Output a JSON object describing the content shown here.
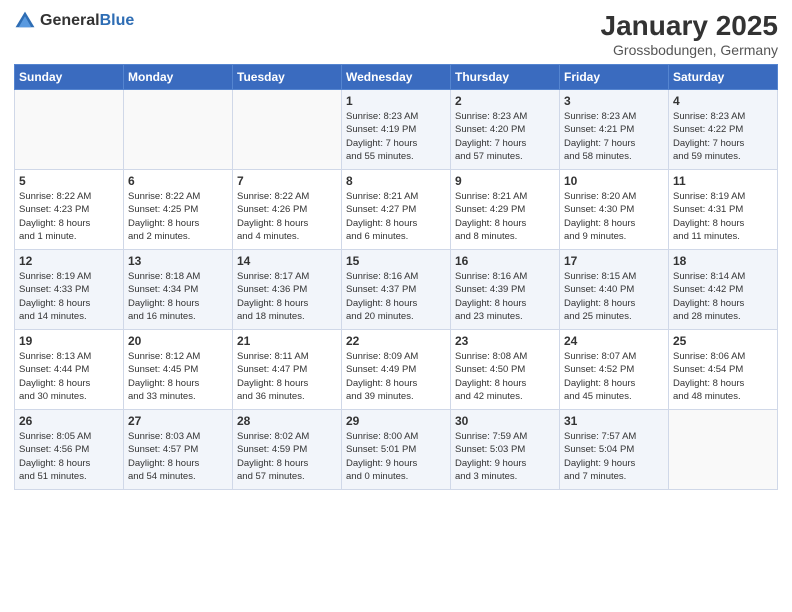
{
  "logo": {
    "general": "General",
    "blue": "Blue"
  },
  "header": {
    "title": "January 2025",
    "location": "Grossbodungen, Germany"
  },
  "days_of_week": [
    "Sunday",
    "Monday",
    "Tuesday",
    "Wednesday",
    "Thursday",
    "Friday",
    "Saturday"
  ],
  "weeks": [
    [
      {
        "day": "",
        "info": ""
      },
      {
        "day": "",
        "info": ""
      },
      {
        "day": "",
        "info": ""
      },
      {
        "day": "1",
        "info": "Sunrise: 8:23 AM\nSunset: 4:19 PM\nDaylight: 7 hours\nand 55 minutes."
      },
      {
        "day": "2",
        "info": "Sunrise: 8:23 AM\nSunset: 4:20 PM\nDaylight: 7 hours\nand 57 minutes."
      },
      {
        "day": "3",
        "info": "Sunrise: 8:23 AM\nSunset: 4:21 PM\nDaylight: 7 hours\nand 58 minutes."
      },
      {
        "day": "4",
        "info": "Sunrise: 8:23 AM\nSunset: 4:22 PM\nDaylight: 7 hours\nand 59 minutes."
      }
    ],
    [
      {
        "day": "5",
        "info": "Sunrise: 8:22 AM\nSunset: 4:23 PM\nDaylight: 8 hours\nand 1 minute."
      },
      {
        "day": "6",
        "info": "Sunrise: 8:22 AM\nSunset: 4:25 PM\nDaylight: 8 hours\nand 2 minutes."
      },
      {
        "day": "7",
        "info": "Sunrise: 8:22 AM\nSunset: 4:26 PM\nDaylight: 8 hours\nand 4 minutes."
      },
      {
        "day": "8",
        "info": "Sunrise: 8:21 AM\nSunset: 4:27 PM\nDaylight: 8 hours\nand 6 minutes."
      },
      {
        "day": "9",
        "info": "Sunrise: 8:21 AM\nSunset: 4:29 PM\nDaylight: 8 hours\nand 8 minutes."
      },
      {
        "day": "10",
        "info": "Sunrise: 8:20 AM\nSunset: 4:30 PM\nDaylight: 8 hours\nand 9 minutes."
      },
      {
        "day": "11",
        "info": "Sunrise: 8:19 AM\nSunset: 4:31 PM\nDaylight: 8 hours\nand 11 minutes."
      }
    ],
    [
      {
        "day": "12",
        "info": "Sunrise: 8:19 AM\nSunset: 4:33 PM\nDaylight: 8 hours\nand 14 minutes."
      },
      {
        "day": "13",
        "info": "Sunrise: 8:18 AM\nSunset: 4:34 PM\nDaylight: 8 hours\nand 16 minutes."
      },
      {
        "day": "14",
        "info": "Sunrise: 8:17 AM\nSunset: 4:36 PM\nDaylight: 8 hours\nand 18 minutes."
      },
      {
        "day": "15",
        "info": "Sunrise: 8:16 AM\nSunset: 4:37 PM\nDaylight: 8 hours\nand 20 minutes."
      },
      {
        "day": "16",
        "info": "Sunrise: 8:16 AM\nSunset: 4:39 PM\nDaylight: 8 hours\nand 23 minutes."
      },
      {
        "day": "17",
        "info": "Sunrise: 8:15 AM\nSunset: 4:40 PM\nDaylight: 8 hours\nand 25 minutes."
      },
      {
        "day": "18",
        "info": "Sunrise: 8:14 AM\nSunset: 4:42 PM\nDaylight: 8 hours\nand 28 minutes."
      }
    ],
    [
      {
        "day": "19",
        "info": "Sunrise: 8:13 AM\nSunset: 4:44 PM\nDaylight: 8 hours\nand 30 minutes."
      },
      {
        "day": "20",
        "info": "Sunrise: 8:12 AM\nSunset: 4:45 PM\nDaylight: 8 hours\nand 33 minutes."
      },
      {
        "day": "21",
        "info": "Sunrise: 8:11 AM\nSunset: 4:47 PM\nDaylight: 8 hours\nand 36 minutes."
      },
      {
        "day": "22",
        "info": "Sunrise: 8:09 AM\nSunset: 4:49 PM\nDaylight: 8 hours\nand 39 minutes."
      },
      {
        "day": "23",
        "info": "Sunrise: 8:08 AM\nSunset: 4:50 PM\nDaylight: 8 hours\nand 42 minutes."
      },
      {
        "day": "24",
        "info": "Sunrise: 8:07 AM\nSunset: 4:52 PM\nDaylight: 8 hours\nand 45 minutes."
      },
      {
        "day": "25",
        "info": "Sunrise: 8:06 AM\nSunset: 4:54 PM\nDaylight: 8 hours\nand 48 minutes."
      }
    ],
    [
      {
        "day": "26",
        "info": "Sunrise: 8:05 AM\nSunset: 4:56 PM\nDaylight: 8 hours\nand 51 minutes."
      },
      {
        "day": "27",
        "info": "Sunrise: 8:03 AM\nSunset: 4:57 PM\nDaylight: 8 hours\nand 54 minutes."
      },
      {
        "day": "28",
        "info": "Sunrise: 8:02 AM\nSunset: 4:59 PM\nDaylight: 8 hours\nand 57 minutes."
      },
      {
        "day": "29",
        "info": "Sunrise: 8:00 AM\nSunset: 5:01 PM\nDaylight: 9 hours\nand 0 minutes."
      },
      {
        "day": "30",
        "info": "Sunrise: 7:59 AM\nSunset: 5:03 PM\nDaylight: 9 hours\nand 3 minutes."
      },
      {
        "day": "31",
        "info": "Sunrise: 7:57 AM\nSunset: 5:04 PM\nDaylight: 9 hours\nand 7 minutes."
      },
      {
        "day": "",
        "info": ""
      }
    ]
  ]
}
